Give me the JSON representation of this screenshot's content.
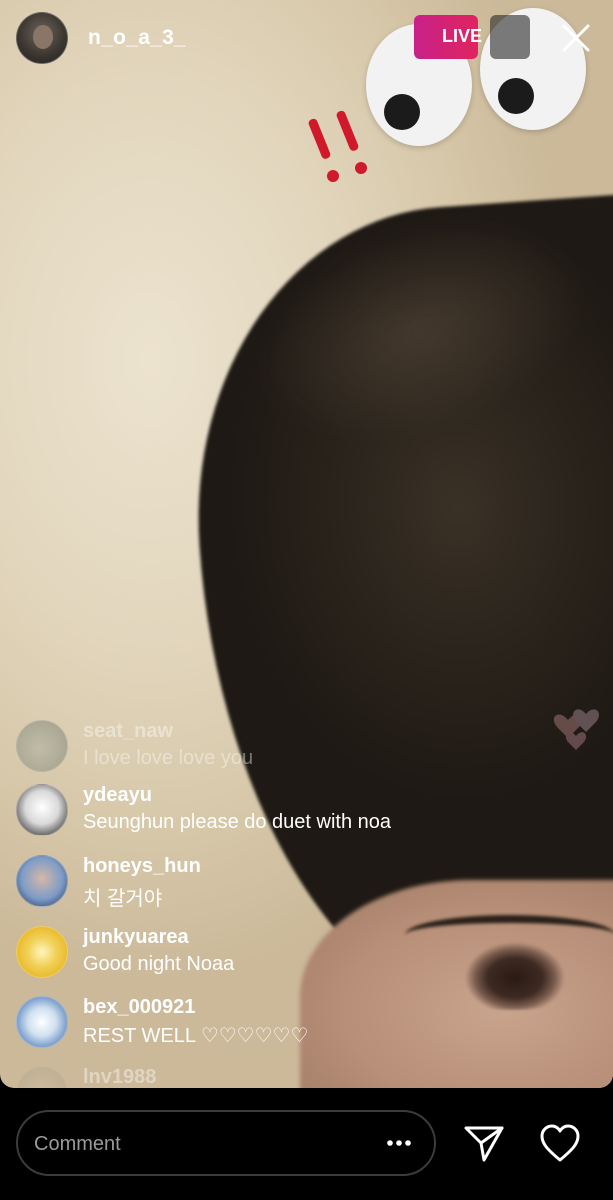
{
  "header": {
    "username": "n_o_a_3_",
    "live_label": "LIVE"
  },
  "comments": [
    {
      "username": "seat_naw",
      "text": "I love love love you",
      "faded": true
    },
    {
      "username": "ydeayu",
      "text": "Seunghun please do duet with noa"
    },
    {
      "username": "honeys_hun",
      "text": "치 갈거야"
    },
    {
      "username": "junkyuarea",
      "text": "Good night Noaa"
    },
    {
      "username": "bex_000921",
      "text": "REST WELL ♡♡♡♡♡♡"
    },
    {
      "username": "lnv1988",
      "text": "",
      "faded": true
    }
  ],
  "bottom_bar": {
    "comment_placeholder": "Comment"
  },
  "icons": {
    "more": "more-horizontal-icon",
    "send": "paper-plane-icon",
    "like": "heart-outline-icon",
    "close": "close-icon"
  },
  "colors": {
    "live_badge": "#e0245e",
    "sticker_exclaim": "#d0192b",
    "input_border": "#3b3b3b"
  }
}
